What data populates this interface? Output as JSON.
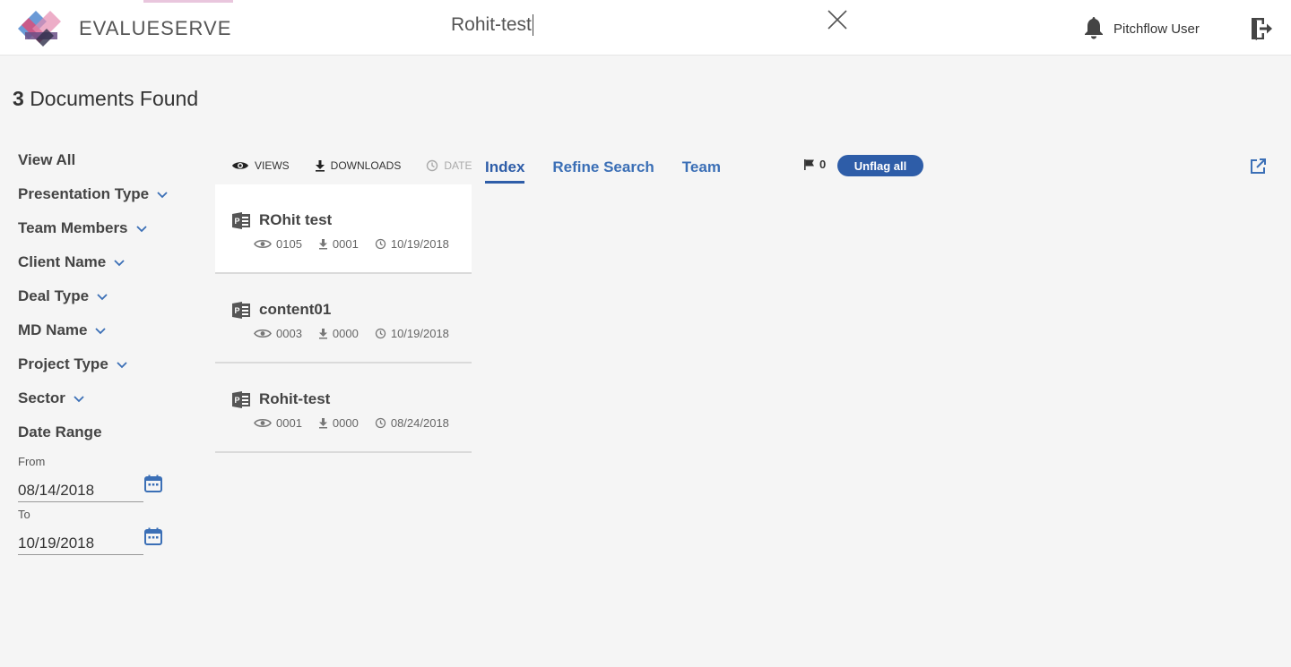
{
  "header": {
    "logo_text": "EVALUESERVE",
    "search_value": "Rohit-test",
    "user_name": "Pitchflow User"
  },
  "results": {
    "count": "3",
    "label": "Documents Found"
  },
  "filters": {
    "items": [
      {
        "label": "View All",
        "has_dropdown": false
      },
      {
        "label": "Presentation Type",
        "has_dropdown": true
      },
      {
        "label": "Team Members",
        "has_dropdown": true
      },
      {
        "label": "Client Name",
        "has_dropdown": true
      },
      {
        "label": "Deal Type",
        "has_dropdown": true
      },
      {
        "label": "MD Name",
        "has_dropdown": true
      },
      {
        "label": "Project Type",
        "has_dropdown": true
      },
      {
        "label": "Sector",
        "has_dropdown": true
      },
      {
        "label": "Date Range",
        "has_dropdown": false
      }
    ],
    "from_label": "From",
    "from_value": "08/14/2018",
    "to_label": "To",
    "to_value": "10/19/2018"
  },
  "sort": {
    "views": "VIEWS",
    "downloads": "DOWNLOADS",
    "date": "DATE"
  },
  "tabs": [
    {
      "label": "Index",
      "active": true
    },
    {
      "label": "Refine Search",
      "active": false
    },
    {
      "label": "Team",
      "active": false
    }
  ],
  "flags": {
    "count": "0",
    "unflag_label": "Unflag all"
  },
  "documents": [
    {
      "title": "ROhit test",
      "views": "0105",
      "downloads": "0001",
      "date": "10/19/2018",
      "selected": true
    },
    {
      "title": "content01",
      "views": "0003",
      "downloads": "0000",
      "date": "10/19/2018",
      "selected": false
    },
    {
      "title": "Rohit-test",
      "views": "0001",
      "downloads": "0000",
      "date": "08/24/2018",
      "selected": false
    }
  ],
  "colors": {
    "accent": "#2e5da8",
    "tab_text": "#3b6fb6",
    "background": "#f5f5f5"
  },
  "icons": {
    "search_clear": "close-icon",
    "notifications": "bell-icon",
    "logout": "logout-icon",
    "external": "external-link-icon",
    "calendar": "calendar-icon",
    "document": "powerpoint-icon"
  }
}
